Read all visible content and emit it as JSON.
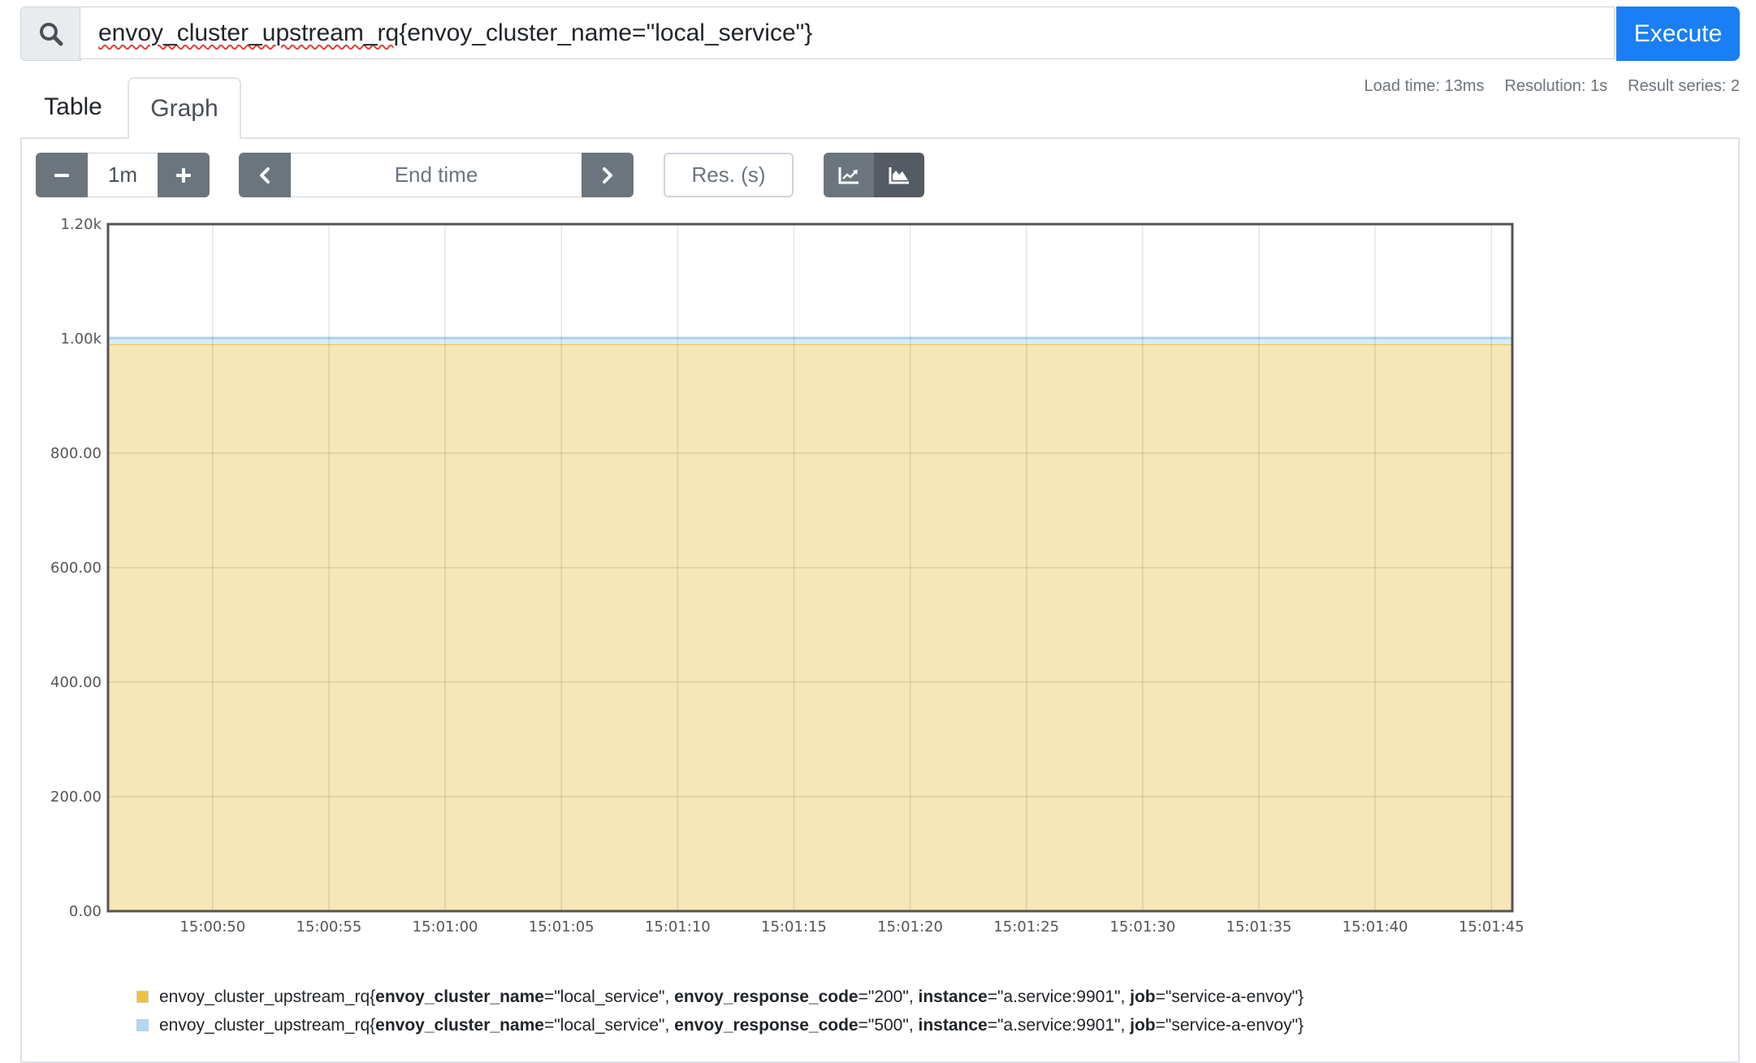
{
  "query": {
    "search_icon": "search-icon",
    "expression_metric": "envoy_cluster_upstream_rq",
    "expression_rest": "{envoy_cluster_name=\"local_service\"}",
    "execute_label": "Execute"
  },
  "tabs": [
    {
      "label": "Table",
      "active": false
    },
    {
      "label": "Graph",
      "active": true
    }
  ],
  "stats": {
    "load_time": "Load time: 13ms",
    "resolution": "Resolution: 1s",
    "result_series": "Result series: 2"
  },
  "controls": {
    "range_minus_icon": "minus-icon",
    "range_value": "1m",
    "range_plus_icon": "plus-icon",
    "prev_icon": "chevron-left-icon",
    "end_time_placeholder": "End time",
    "next_icon": "chevron-right-icon",
    "resolution_placeholder": "Res. (s)",
    "chart_type_line_icon": "line-chart-icon",
    "chart_type_stacked_icon": "area-chart-icon",
    "chart_type_selected": "stacked"
  },
  "colors": {
    "execute": "#1a7ef5",
    "series_200": "#edc240",
    "series_500": "#afd8f8",
    "series_200_fill": "#f7e6b6",
    "series_500_fill": "#d8ebfb"
  },
  "chart_data": {
    "type": "area",
    "stacked": true,
    "title": "",
    "xlabel": "",
    "ylabel": "",
    "x_range": [
      "15:00:45.5",
      "15:01:45.9"
    ],
    "x_tick_labels": [
      "15:00:50",
      "15:00:55",
      "15:01:00",
      "15:01:05",
      "15:01:10",
      "15:01:15",
      "15:01:20",
      "15:01:25",
      "15:01:30",
      "15:01:35",
      "15:01:40",
      "15:01:45"
    ],
    "ylim": [
      0,
      1200
    ],
    "y_ticks": [
      0,
      200,
      400,
      600,
      800,
      1000,
      1200
    ],
    "y_tick_labels": [
      "0.00",
      "200.00",
      "400.00",
      "600.00",
      "800.00",
      "1.00k",
      "1.20k"
    ],
    "grid": true,
    "legend_position": "bottom",
    "series": [
      {
        "name": "envoy_cluster_upstream_rq{envoy_cluster_name=\"local_service\", envoy_response_code=\"200\", instance=\"a.service:9901\", job=\"service-a-envoy\"}",
        "color": "#edc240",
        "value_constant": 990
      },
      {
        "name": "envoy_cluster_upstream_rq{envoy_cluster_name=\"local_service\", envoy_response_code=\"500\", instance=\"a.service:9901\", job=\"service-a-envoy\"}",
        "color": "#afd8f8",
        "value_constant": 12
      }
    ]
  },
  "legend": [
    {
      "color": "#edc240",
      "metric": "envoy_cluster_upstream_rq{",
      "labels": [
        {
          "key": "envoy_cluster_name",
          "value": "=\"local_service\", "
        },
        {
          "key": "envoy_response_code",
          "value": "=\"200\", "
        },
        {
          "key": "instance",
          "value": "=\"a.service:9901\", "
        },
        {
          "key": "job",
          "value": "=\"service-a-envoy\"}"
        }
      ]
    },
    {
      "color": "#afd8f8",
      "metric": "envoy_cluster_upstream_rq{",
      "labels": [
        {
          "key": "envoy_cluster_name",
          "value": "=\"local_service\", "
        },
        {
          "key": "envoy_response_code",
          "value": "=\"500\", "
        },
        {
          "key": "instance",
          "value": "=\"a.service:9901\", "
        },
        {
          "key": "job",
          "value": "=\"service-a-envoy\"}"
        }
      ]
    }
  ]
}
